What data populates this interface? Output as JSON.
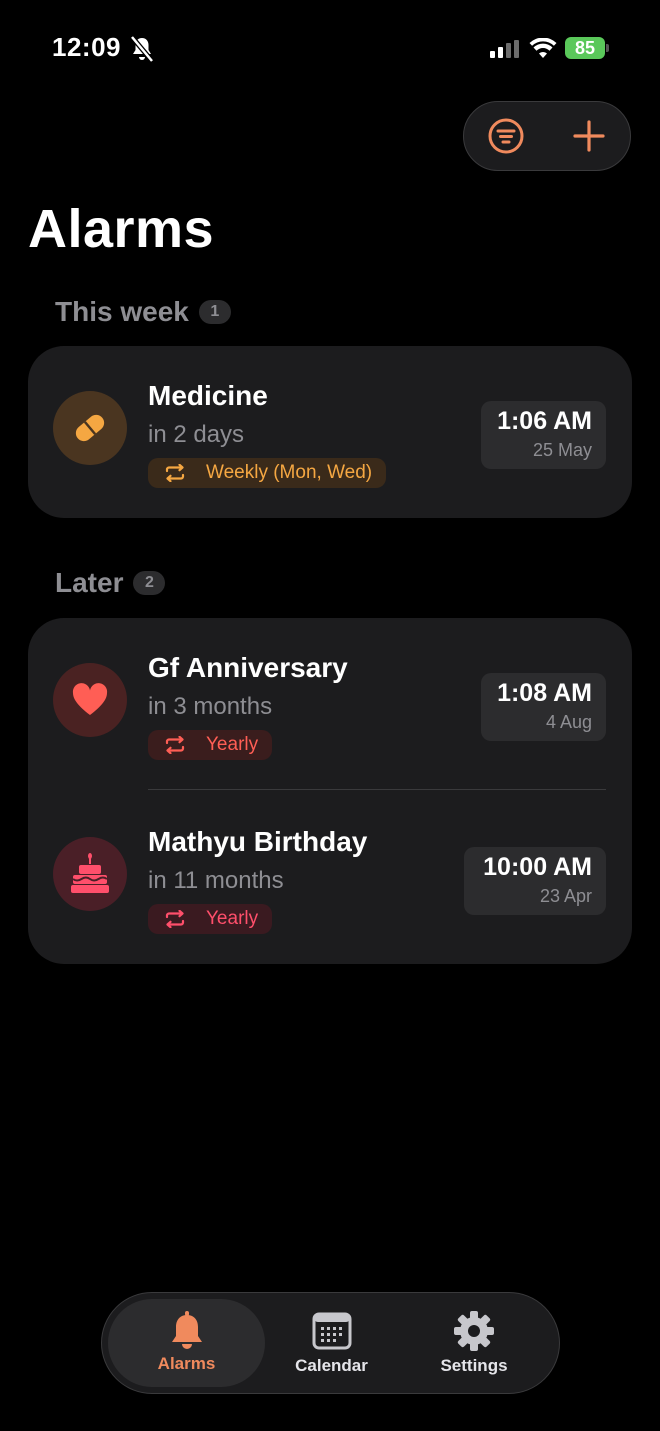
{
  "status_bar": {
    "time": "12:09",
    "battery": "85"
  },
  "page": {
    "title": "Alarms"
  },
  "sections": [
    {
      "title": "This week",
      "count": "1",
      "alarms": [
        {
          "name": "Medicine",
          "relative": "in 2 days",
          "repeat": "Weekly (Mon, Wed)",
          "time": "1:06 AM",
          "date": "25 May",
          "icon": "pill-icon",
          "accent": "#f5a742",
          "icon_bg": "#4a3520",
          "chip_bg": "#3a2a1a"
        }
      ]
    },
    {
      "title": "Later",
      "count": "2",
      "alarms": [
        {
          "name": "Gf Anniversary",
          "relative": "in 3 months",
          "repeat": "Yearly",
          "time": "1:08 AM",
          "date": "4 Aug",
          "icon": "heart-icon",
          "accent": "#ff5e55",
          "icon_bg": "#4a2222",
          "chip_bg": "#3a1d1d"
        },
        {
          "name": "Mathyu Birthday",
          "relative": "in 11 months",
          "repeat": "Yearly",
          "time": "10:00 AM",
          "date": "23 Apr",
          "icon": "cake-icon",
          "accent": "#ff4f6b",
          "icon_bg": "#4a1f27",
          "chip_bg": "#3a1a20"
        }
      ]
    }
  ],
  "tabs": [
    {
      "label": "Alarms",
      "icon": "bell-icon",
      "active": true
    },
    {
      "label": "Calendar",
      "icon": "calendar-icon",
      "active": false
    },
    {
      "label": "Settings",
      "icon": "gear-icon",
      "active": false
    }
  ],
  "colors": {
    "accent": "#f08a5d",
    "background": "#000000",
    "card": "#1c1c1e"
  }
}
